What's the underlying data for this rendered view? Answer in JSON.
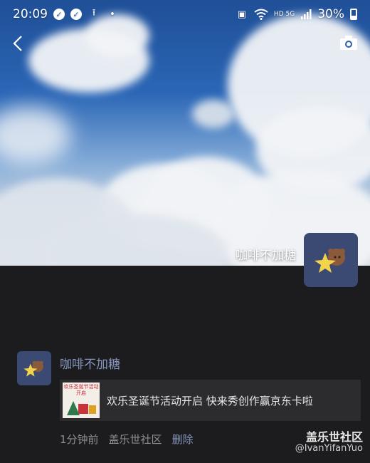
{
  "status_bar": {
    "time": "20:09",
    "battery": "30%",
    "network": "HD",
    "network_gen": "5G"
  },
  "profile": {
    "name": "咖啡不加糖"
  },
  "post": {
    "author": "咖啡不加糖",
    "link_text": "欢乐圣诞节活动开启 快来秀创作赢京东卡啦",
    "thumb_caption": "欢乐圣诞节活动开启",
    "time_ago": "1分钟前",
    "source": "盖乐世社区",
    "delete_label": "删除"
  },
  "watermark": {
    "title": "盖乐世社区",
    "handle": "@IvanYifanYuo"
  },
  "colors": {
    "background": "#1c1c1e",
    "author_link": "#8796bf",
    "avatar_bg": "#3b4a73"
  },
  "icons": [
    "back-icon",
    "camera-icon",
    "wifi-icon",
    "signal-icon",
    "battery-icon",
    "upload-icon",
    "notification-icon"
  ]
}
